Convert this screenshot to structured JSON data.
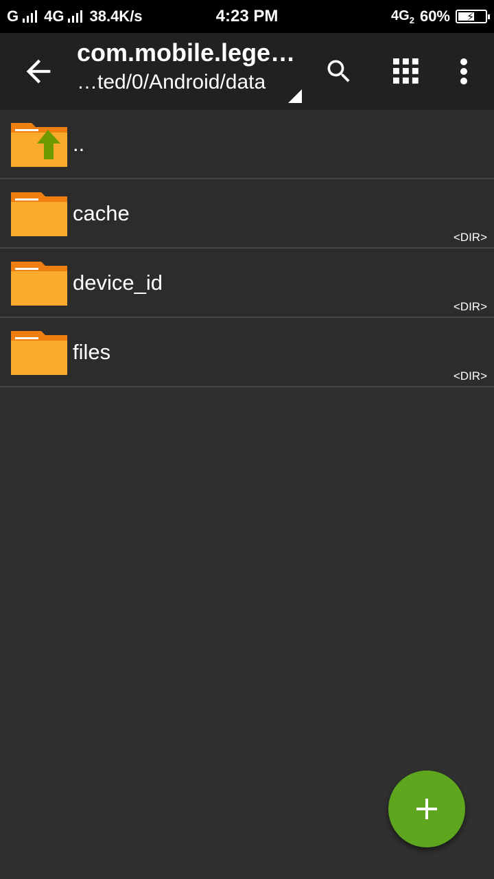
{
  "status_bar": {
    "carrier1": "G",
    "carrier2": "4G",
    "net_speed": "38.4K/s",
    "time": "4:23 PM",
    "right_network": "4G",
    "right_sim": "2",
    "battery": "60%",
    "battery_level": 0.6
  },
  "toolbar": {
    "title": "com.mobile.lege…",
    "path": "…ted/0/Android/data",
    "icons": [
      "back-arrow-icon",
      "search-icon",
      "grid-view-icon",
      "more-vert-icon"
    ]
  },
  "files": [
    {
      "name": "..",
      "tag": "",
      "icon": "folder-up-icon"
    },
    {
      "name": "cache",
      "tag": "<DIR>",
      "icon": "folder-icon"
    },
    {
      "name": "device_id",
      "tag": "<DIR>",
      "icon": "folder-icon"
    },
    {
      "name": "files",
      "tag": "<DIR>",
      "icon": "folder-icon"
    }
  ],
  "fab": {
    "label": "+",
    "color": "#5ea61d"
  },
  "colors": {
    "folder": "#fbab2b",
    "folder_tab": "#f07f12",
    "up_arrow": "#6e9a00"
  }
}
